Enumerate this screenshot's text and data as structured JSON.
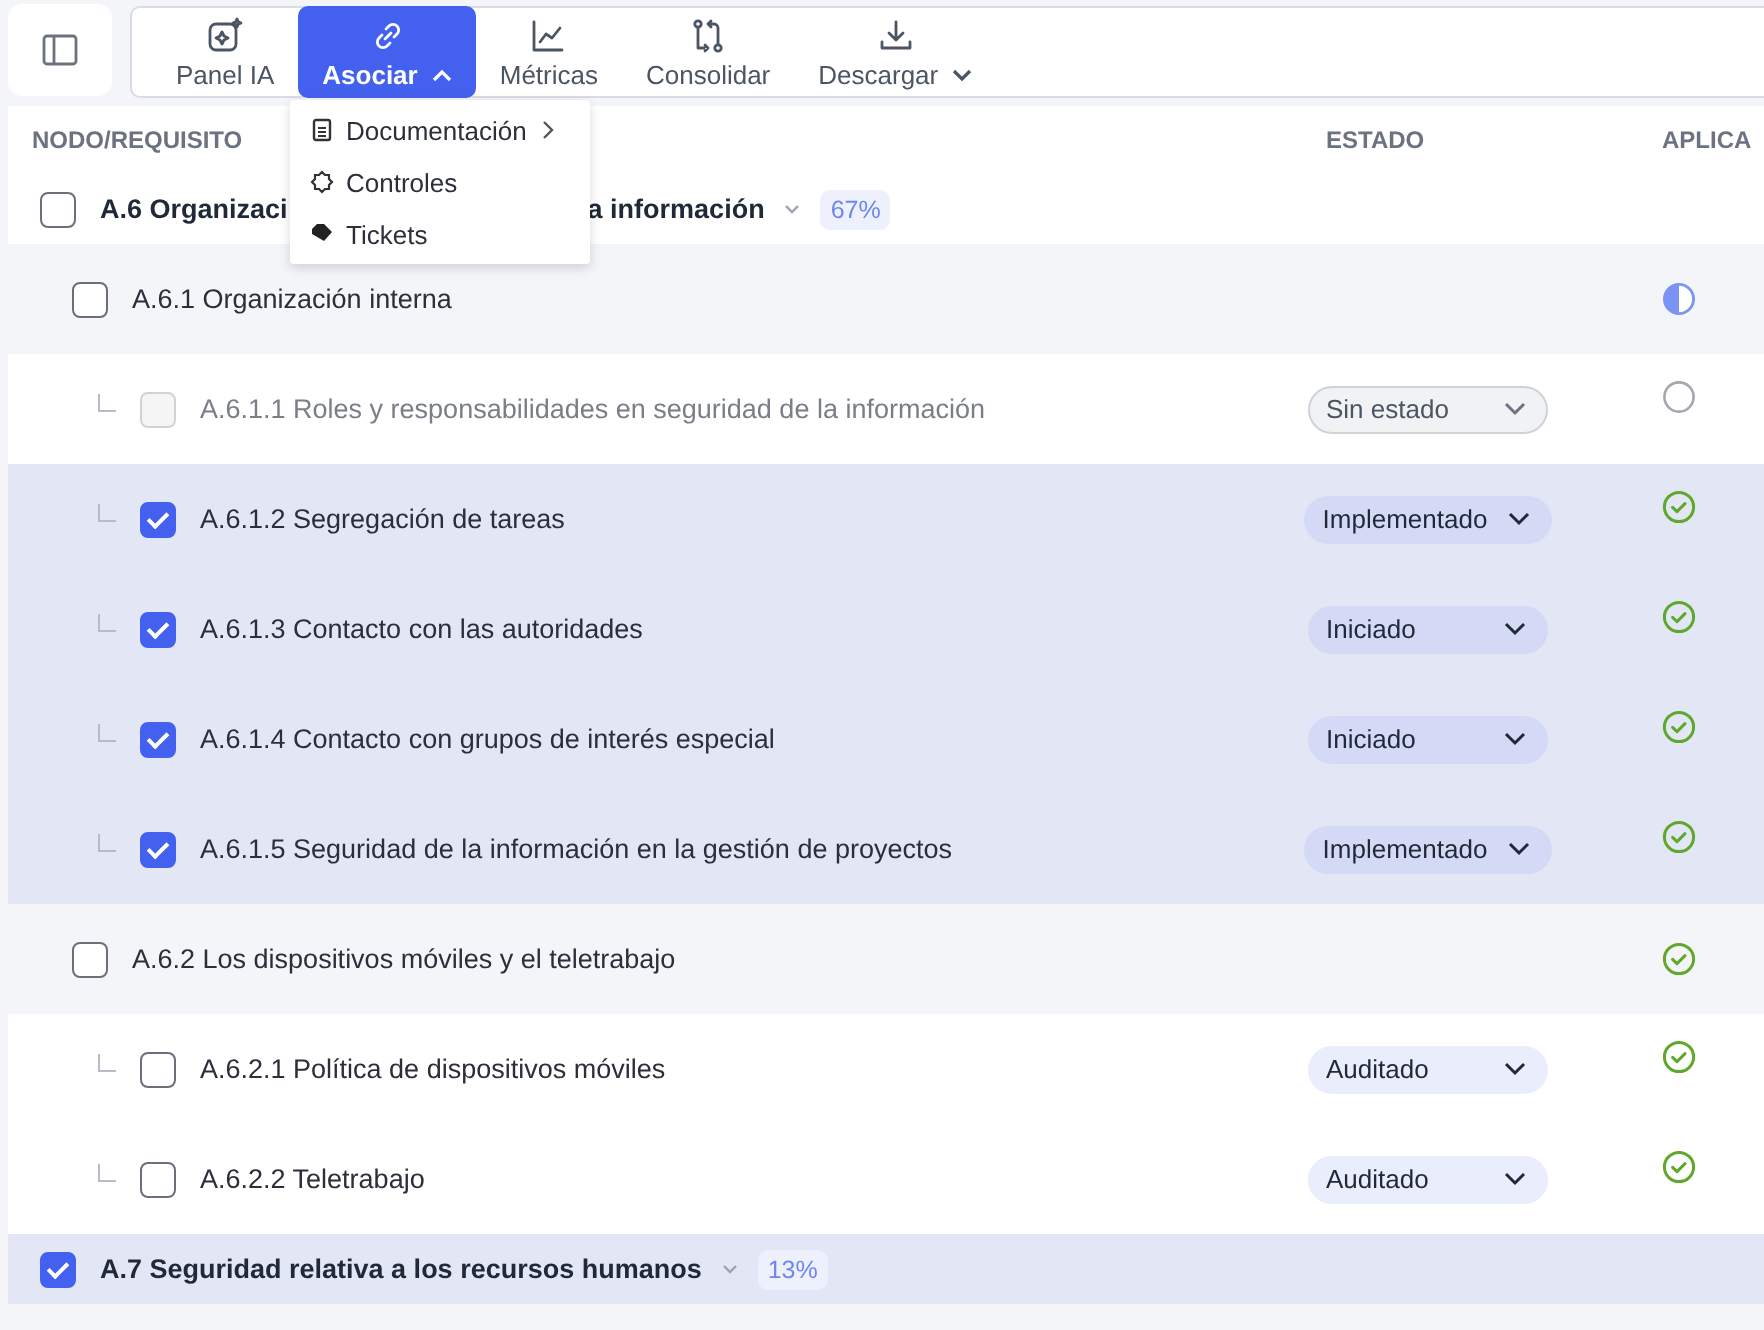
{
  "toolbar": {
    "items": [
      {
        "label": "Panel IA",
        "selected": false
      },
      {
        "label": "Asociar",
        "selected": true,
        "expanded": true
      },
      {
        "label": "Métricas",
        "selected": false
      },
      {
        "label": "Consolidar",
        "selected": false
      },
      {
        "label": "Descargar",
        "selected": false,
        "expanded": false
      }
    ]
  },
  "menu": {
    "items": [
      {
        "label": "Documentación",
        "has_submenu": true
      },
      {
        "label": "Controles",
        "has_submenu": false
      },
      {
        "label": "Tickets",
        "has_submenu": false
      }
    ]
  },
  "table": {
    "columns": [
      "NODO/REQUISITO",
      "ESTADO",
      "APLICA"
    ],
    "rows": [
      {
        "label": "A.6 Organizaci",
        "label_end": "a información",
        "checked": false,
        "disabled": false,
        "badge": "67%",
        "children": [
          {
            "label": "A.6.1 Organización interna",
            "checked": false,
            "disabled": false,
            "applies": true,
            "partial": true,
            "children": [
              {
                "label": "A.6.1.1 Roles y responsabilidades en seguridad de la información",
                "checked": false,
                "disabled": true,
                "status": "Sin estado",
                "applies": false
              },
              {
                "label": "A.6.1.2 Segregación de tareas",
                "checked": true,
                "disabled": false,
                "status": "Implementado",
                "applies": true,
                "partial": false
              },
              {
                "label": "A.6.1.3 Contacto con las autoridades",
                "checked": true,
                "disabled": false,
                "status": "Iniciado",
                "applies": true,
                "partial": false
              },
              {
                "label": "A.6.1.4 Contacto con grupos de interés especial",
                "checked": true,
                "disabled": false,
                "status": "Iniciado",
                "applies": true,
                "partial": false
              },
              {
                "label": "A.6.1.5 Seguridad de la información en la gestión de proyectos",
                "checked": true,
                "disabled": false,
                "status": "Implementado",
                "applies": true,
                "partial": false
              }
            ]
          },
          {
            "label": "A.6.2 Los dispositivos móviles y el teletrabajo",
            "checked": false,
            "disabled": false,
            "applies": true,
            "partial": false,
            "children": [
              {
                "label": "A.6.2.1 Política de dispositivos móviles",
                "checked": false,
                "disabled": false,
                "status": "Auditado",
                "applies": true,
                "partial": false
              },
              {
                "label": "A.6.2.2 Teletrabajo",
                "checked": false,
                "disabled": false,
                "status": "Auditado",
                "applies": true,
                "partial": false
              }
            ]
          }
        ]
      },
      {
        "label": "A.7 Seguridad relativa a los recursos humanos",
        "checked": true,
        "disabled": false,
        "badge": "13%"
      }
    ]
  }
}
